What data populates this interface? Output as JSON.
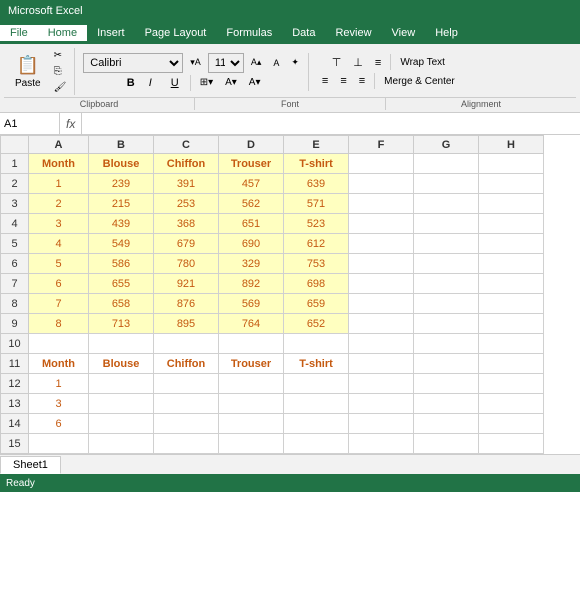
{
  "title": "Microsoft Excel",
  "menus": [
    "File",
    "Home",
    "Insert",
    "Page Layout",
    "Formulas",
    "Data",
    "Review",
    "View",
    "Help"
  ],
  "active_menu": "Home",
  "ribbon": {
    "font_family": "Calibri",
    "font_size": "11",
    "wrap_text_label": "Wrap Text",
    "merge_label": "Merge & Center",
    "bold_label": "B",
    "italic_label": "I",
    "underline_label": "U",
    "clipboard_label": "Clipboard",
    "font_label": "Font",
    "alignment_label": "Alignment"
  },
  "name_box": "A1",
  "fx_label": "fx",
  "columns": [
    "",
    "A",
    "B",
    "C",
    "D",
    "E",
    "F",
    "G",
    "H"
  ],
  "col_classes": [
    "row-header",
    "col-a",
    "col-b",
    "col-c",
    "col-d",
    "col-e",
    "col-f",
    "col-g",
    "col-h"
  ],
  "data_table1": {
    "headers": [
      "Month",
      "Blouse",
      "Chiffon",
      "Trouser",
      "T-shirt"
    ],
    "rows": [
      [
        "1",
        "239",
        "391",
        "457",
        "639"
      ],
      [
        "2",
        "215",
        "253",
        "562",
        "571"
      ],
      [
        "3",
        "439",
        "368",
        "651",
        "523"
      ],
      [
        "4",
        "549",
        "679",
        "690",
        "612"
      ],
      [
        "5",
        "586",
        "780",
        "329",
        "753"
      ],
      [
        "6",
        "655",
        "921",
        "892",
        "698"
      ],
      [
        "7",
        "658",
        "876",
        "569",
        "659"
      ],
      [
        "8",
        "713",
        "895",
        "764",
        "652"
      ]
    ]
  },
  "data_table2": {
    "headers": [
      "Month",
      "Blouse",
      "Chiffon",
      "Trouser",
      "T-shirt"
    ],
    "rows": [
      [
        "1",
        "",
        "",
        "",
        ""
      ],
      [
        "3",
        "",
        "",
        "",
        ""
      ],
      [
        "6",
        "",
        "",
        "",
        ""
      ]
    ]
  },
  "row_numbers": [
    1,
    2,
    3,
    4,
    5,
    6,
    7,
    8,
    9,
    10,
    11,
    12,
    13,
    14,
    15
  ],
  "sheet_tab": "Sheet1",
  "status": "Ready"
}
